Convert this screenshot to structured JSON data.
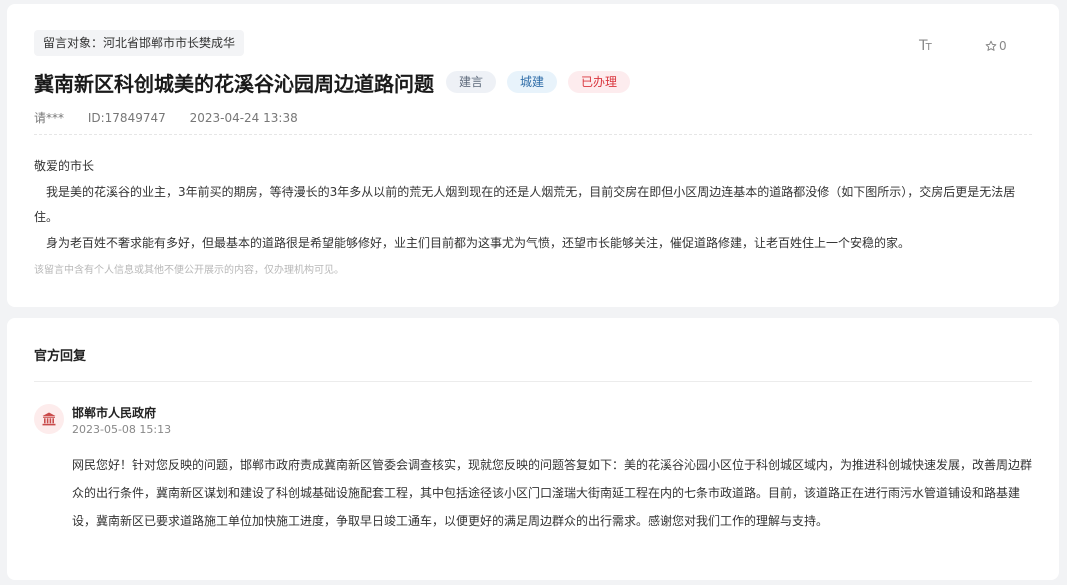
{
  "message": {
    "target_label": "留言对象：河北省邯郸市市长樊成华",
    "title": "冀南新区科创城美的花溪谷沁园周边道路问题",
    "tags": {
      "type": "建言",
      "category": "城建",
      "status": "已办理"
    },
    "author": "请***",
    "id": "ID:17849747",
    "date": "2023-04-24 13:38",
    "body": [
      "敬爱的市长",
      "　我是美的花溪谷的业主，3年前买的期房，等待漫长的3年多从以前的荒无人烟到现在的还是人烟荒无，目前交房在即但小区周边连基本的道路都没修（如下图所示），交房后更是无法居住。",
      "　身为老百姓不奢求能有多好，但最基本的道路很是希望能够修好，业主们目前都为这事尤为气愤，还望市长能够关注，催促道路修建，让老百姓住上一个安稳的家。"
    ],
    "privacy_note": "该留言中含有个人信息或其他不便公开展示的内容，仅办理机构可见。"
  },
  "toolbar": {
    "font_size_icon": "font-size-icon",
    "favorite_icon": "star-icon",
    "favorite_count": "0"
  },
  "reply": {
    "section_title": "官方回复",
    "department": "邯郸市人民政府",
    "time": "2023-05-08 15:13",
    "avatar_icon": "government-building-icon",
    "text": "网民您好！针对您反映的问题，邯郸市政府责成冀南新区管委会调查核实，现就您反映的问题答复如下：美的花溪谷沁园小区位于科创城区域内，为推进科创城快速发展，改善周边群众的出行条件，冀南新区谋划和建设了科创城基础设施配套工程，其中包括途径该小区门口滏瑞大街南延工程在内的七条市政道路。目前，该道路正在进行雨污水管道铺设和路基建设，冀南新区已要求道路施工单位加快施工进度，争取早日竣工通车，以便更好的满足周边群众的出行需求。感谢您对我们工作的理解与支持。"
  },
  "colors": {
    "status_red": "#d9363e",
    "category_blue": "#2f6da8",
    "avatar_red": "#c94b4b"
  }
}
